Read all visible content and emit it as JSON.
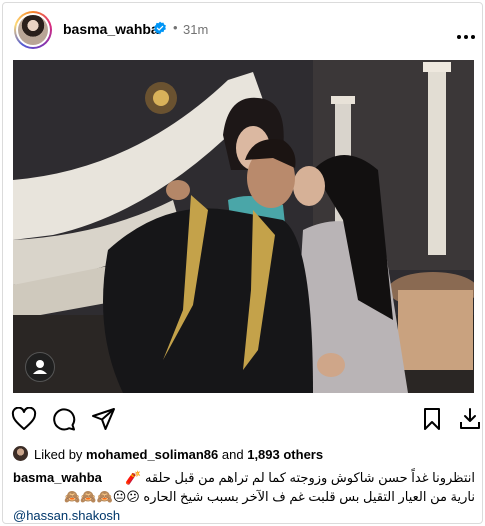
{
  "post": {
    "username": "basma_wahba",
    "dot": "•",
    "time": "31m"
  },
  "likes": {
    "prefix": "Liked by",
    "liker": "mohamed_soliman86",
    "joiner": "and",
    "others": "1,893 others"
  },
  "caption": {
    "username": "basma_wahba",
    "line1": "انتظرونا غداً حسن شاكوش وزوجته كما لم تراهم من قبل حلقه 🧨",
    "line2": "نارية من العيار التقيل بس قلبت غم ف الآخر بسبب شيخ الحاره 😕😐🙈🙈🙈",
    "mention": "@hassan.shakosh"
  },
  "icons": {
    "verified": "verified-badge-icon",
    "more": "more-options-icon",
    "like": "heart-icon",
    "comment": "comment-icon",
    "share": "share-icon",
    "save": "bookmark-icon",
    "tag": "user-tag-icon"
  },
  "colors": {
    "verified": "#0095f6",
    "link": "#00376b",
    "muted": "#737373"
  }
}
